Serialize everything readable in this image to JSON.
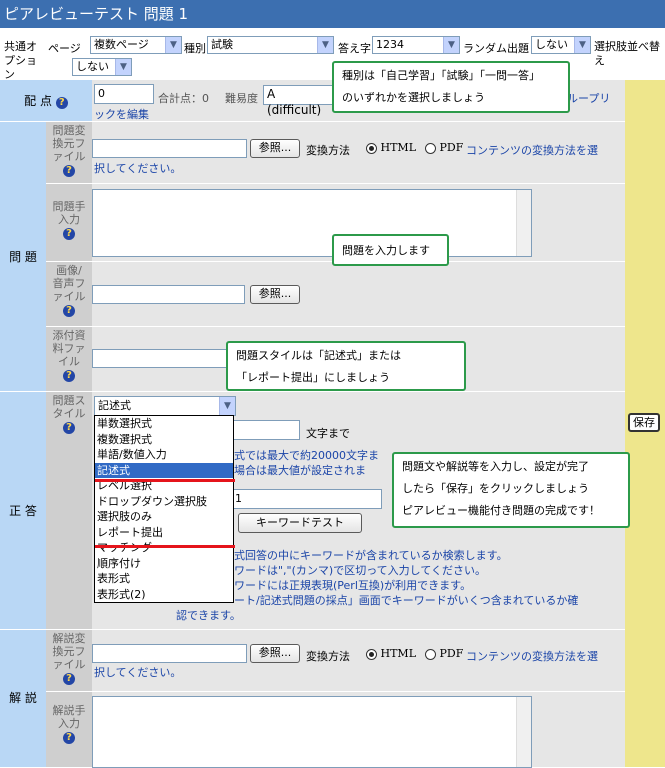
{
  "title": "ピアレビューテスト 問題 1",
  "common": {
    "label": "共通オプション",
    "page_label": "ページ",
    "page_value": "複数ページ",
    "type_label": "種別",
    "type_value": "試験",
    "answer_label": "答え字",
    "answer_value": "1234",
    "random_label": "ランダム出題",
    "random_value": "しない",
    "shuffle_label": "選択肢並べ替え",
    "shuffle_value": "しない"
  },
  "score": {
    "label": "配 点",
    "value": "0",
    "total_label": "合計点：0",
    "difficulty_label": "難易度",
    "difficulty_value": "A (difficult)",
    "rubric_link_tail": "ループリ",
    "rubric_link_edit": "ックを編集"
  },
  "question": {
    "label": "問 題",
    "convert_file_label": "問題変換元ファイル",
    "browse_label": "参照...",
    "convert_method_label": "変換方法",
    "html_label": "HTML",
    "pdf_label": "PDF",
    "convert_link_1": "コンテンツの変換方法を選",
    "convert_link_2": "択してください。",
    "manual_input_label": "問題手入力",
    "media_file_label": "画像/音声ファイル",
    "attach_label": "添付資料ファイル"
  },
  "answer": {
    "label": "正 答",
    "style_label": "問題スタイル",
    "style_value": "記述式",
    "options": [
      "単数選択式",
      "複数選択式",
      "単語/数値入力",
      "記述式",
      "レベル選択",
      "ドロップダウン選択肢",
      "選択肢のみ",
      "レポート提出",
      "マッチング",
      "順序付け",
      "表形式",
      "表形式(2)"
    ],
    "chars_suffix": "文字まで",
    "limit_line_1": "式では最大で約20000文字ま",
    "limit_line_2": "場合は最大値が設定されま",
    "keyword_value": "1",
    "keyword_test_button": "キーワードテスト",
    "help_1": "式回答の中にキーワードが含まれているか検索します。",
    "help_2": "ワードは\",\"(カンマ)で区切って入力してください。",
    "help_3": "ワードには正規表現(Perl互換)が利用できます。",
    "help_4": "ート/記述式問題の採点」画面でキーワードがいくつ含まれているか確",
    "help_5": "認できます。"
  },
  "explanation": {
    "label": "解 説",
    "convert_file_label": "解説変換元ファイル",
    "manual_input_label": "解説手入力"
  },
  "save_button": "保存",
  "callouts": {
    "type_hint_1": "種別は「自己学習」「試験」「一問一答」",
    "type_hint_2": "のいずれかを選択しましょう",
    "question_hint": "問題を入力します",
    "style_hint_1": "問題スタイルは「記述式」または",
    "style_hint_2": "「レポート提出」にしましょう",
    "save_hint_1": "問題文や解説等を入力し、設定が完了",
    "save_hint_2": "したら「保存」をクリックしましょう",
    "save_hint_3": "ピアレビュー機能付き問題の完成です！"
  }
}
